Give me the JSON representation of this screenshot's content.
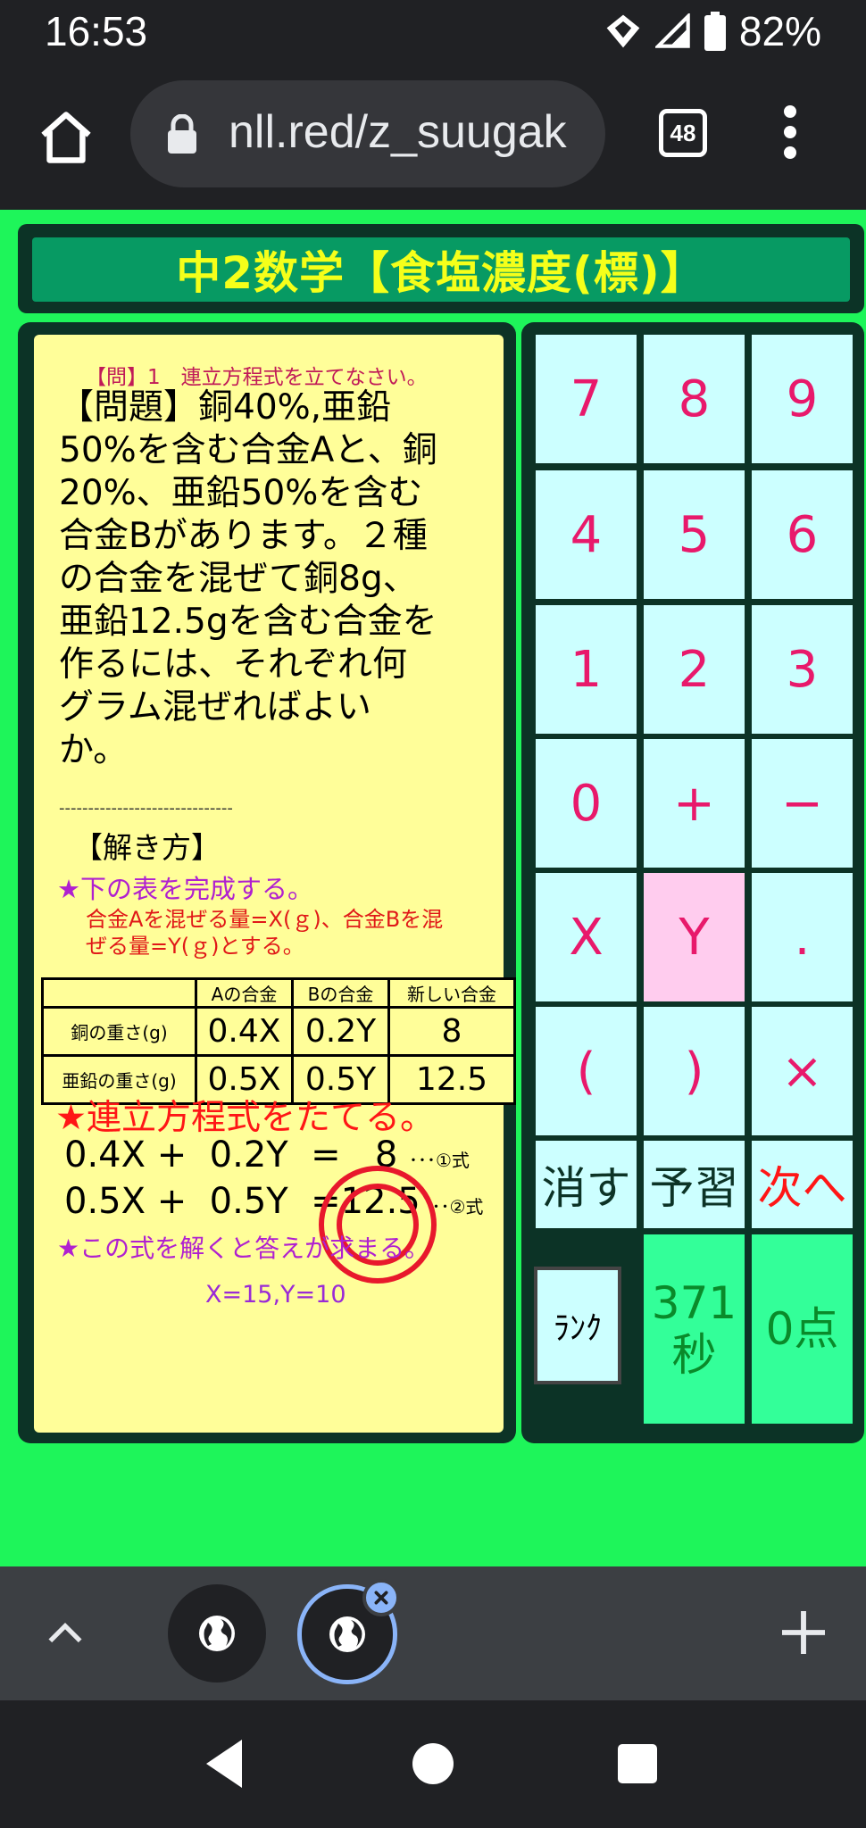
{
  "status_bar": {
    "time": "16:53",
    "battery": "82%"
  },
  "browser": {
    "url": "nll.red/z_suugak",
    "tab_count": "48"
  },
  "page_title": "中2数学【食塩濃度(標)】",
  "question": {
    "label": "【問】1　連立方程式を立てなさい。",
    "lines": [
      "【問題】銅40%,亜鉛",
      "50%を含む合金Aと、銅",
      "20%、亜鉛50%を含む",
      "合金Bがあります。２種",
      "の合金を混ぜて銅8g、",
      "亜鉛12.5gを含む合金を",
      "作るには、それぞれ何",
      "グラム混ぜればよい",
      "か。"
    ]
  },
  "divider": "------------------------------",
  "solution": {
    "heading": "【解き方】",
    "step1": "★下の表を完成する。",
    "note_line1": "合金Aを混ぜる量=X(ｇ)、合金Bを混",
    "note_line2": "ぜる量=Y(ｇ)とする。",
    "table": {
      "headers": [
        "",
        "Aの合金",
        "Bの合金",
        "新しい合金"
      ],
      "rows": [
        [
          "銅の重さ(g)",
          "0.4X",
          "0.2Y",
          "8"
        ],
        [
          "亜鉛の重さ(g)",
          "0.5X",
          "0.5Y",
          "12.5"
        ]
      ]
    },
    "step2": "★連立方程式をたてる。",
    "eq1": "0.4X +  0.2Y  =   8",
    "eq1_tag": "･･･①式",
    "eq2": "0.5X +  0.5Y  =12.5",
    "eq2_tag": "･･②式",
    "step3": "★この式を解くと答えが求まる。",
    "answer": "X=15,Y=10"
  },
  "keypad": {
    "keys": [
      "7",
      "8",
      "9",
      "4",
      "5",
      "6",
      "1",
      "2",
      "3",
      "0",
      "+",
      "−",
      "X",
      "Y",
      ".",
      "(",
      ")",
      "×"
    ],
    "delete": "消す",
    "preview": "予習",
    "next": "次へ",
    "rank": "ﾗﾝｸ",
    "timer_value": "371",
    "timer_unit": "秒",
    "score": "0点"
  }
}
